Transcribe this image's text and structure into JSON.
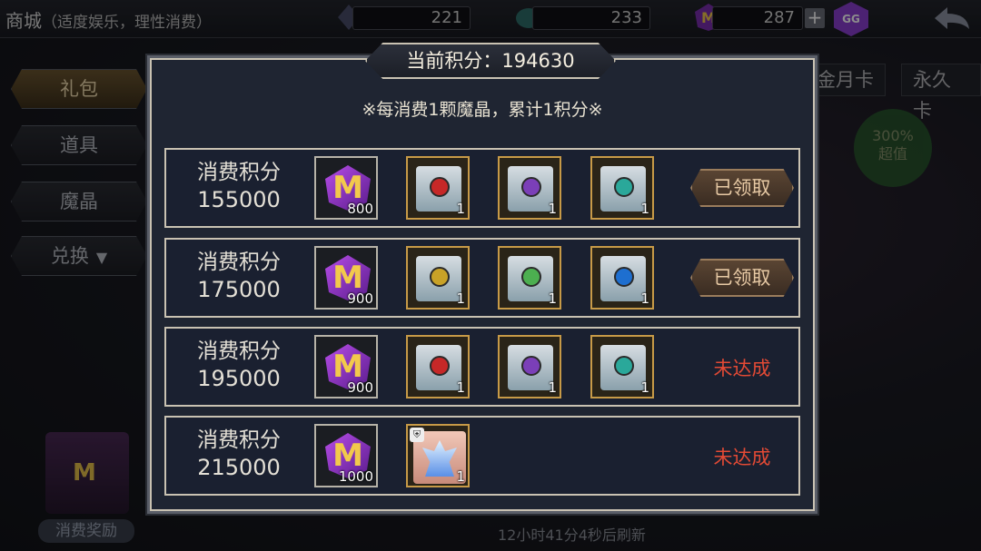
{
  "topbar": {
    "title": "商城",
    "subtitle": "（适度娱乐，理性消费）",
    "res1": "221",
    "res2": "233",
    "res3": "287",
    "plus": "+",
    "gg": "GG"
  },
  "sidebar": {
    "items": [
      {
        "label": "礼包"
      },
      {
        "label": "道具"
      },
      {
        "label": "魔晶"
      },
      {
        "label": "兑换"
      }
    ]
  },
  "right_tabs": [
    "金月卡",
    "永久卡"
  ],
  "badge": {
    "line1": "300%",
    "line2": "超值"
  },
  "bottom": {
    "reward_label": "消费奖励",
    "refresh": "12小时41分4秒后刷新"
  },
  "modal": {
    "score_label": "当前积分：",
    "score_value": "194630",
    "note": "※每消费1颗魔晶，累计1积分※",
    "row_label": "消费积分",
    "rows": [
      {
        "threshold": "155000",
        "crystal": "800",
        "status": "已领取"
      },
      {
        "threshold": "175000",
        "crystal": "900",
        "status": "已领取"
      },
      {
        "threshold": "195000",
        "crystal": "900",
        "status": "未达成"
      },
      {
        "threshold": "215000",
        "crystal": "1000",
        "status": "未达成"
      }
    ],
    "item_count": "1"
  },
  "colors": {
    "accent_gold": "#c79a47",
    "unreached_red": "#e34a35",
    "crystal_purple": "#b74de8"
  }
}
